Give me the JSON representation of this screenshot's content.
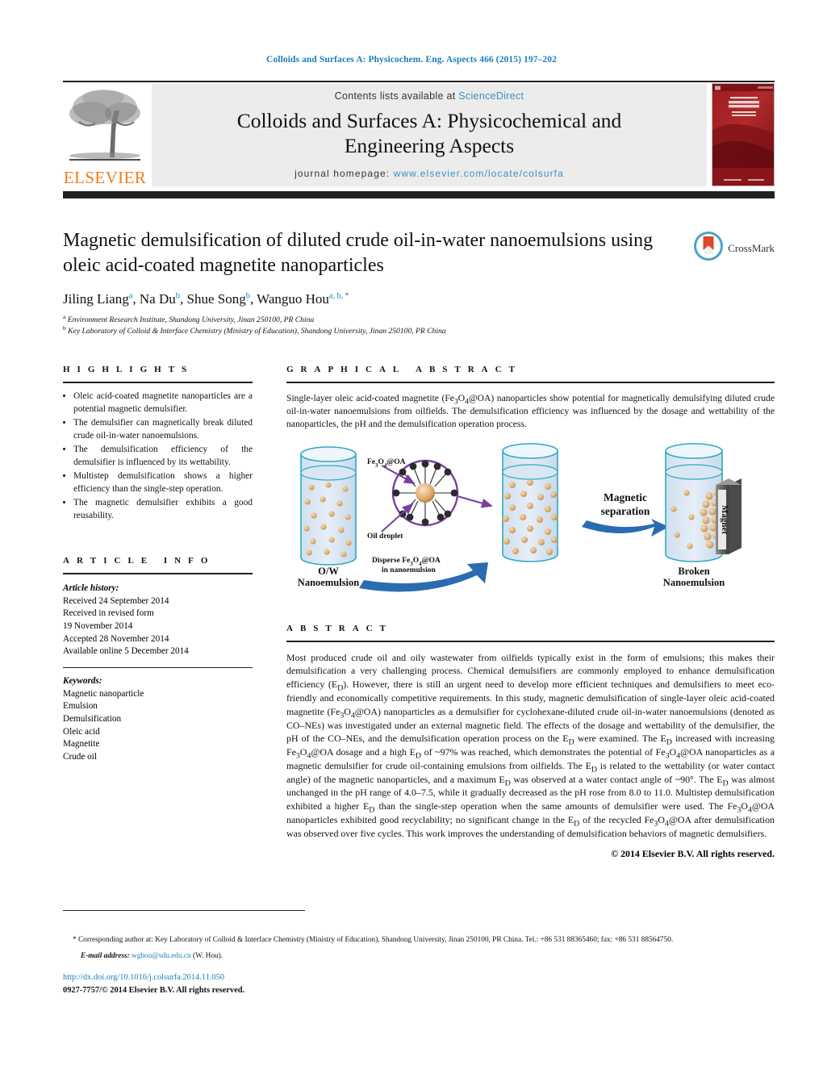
{
  "running_head": "Colloids and Surfaces A: Physicochem. Eng. Aspects 466 (2015) 197–202",
  "masthead": {
    "contents_prefix": "Contents lists available at ",
    "sciencedirect": "ScienceDirect",
    "journal_title_line1": "Colloids and Surfaces A: Physicochemical and",
    "journal_title_line2": "Engineering Aspects",
    "homepage_label": "journal homepage: ",
    "homepage_url": "www.elsevier.com/locate/colsurfa",
    "publisher": "ELSEVIER",
    "cover_line1": "COLLOIDS AND",
    "cover_line2": "SURFACES A",
    "cover_sub": "Physicochemical and Engineering Aspects"
  },
  "article": {
    "title": "Magnetic demulsification of diluted crude oil-in-water nanoemulsions using oleic acid-coated magnetite nanoparticles",
    "crossmark_label": "CrossMark",
    "authors_html": "Jiling Liang<sup>a</sup>, Na Du<sup>b</sup>, Shue Song<sup>b</sup>, Wanguo Hou<sup>a, b, *</sup>",
    "affiliations": [
      {
        "marker": "a",
        "text": "Environment Research Institute, Shandong University, Jinan 250100, PR China"
      },
      {
        "marker": "b",
        "text": "Key Laboratory of Colloid & Interface Chemistry (Ministry of Education), Shandong University, Jinan 250100, PR China"
      }
    ]
  },
  "highlights": {
    "heading": "HIGHLIGHTS",
    "items": [
      "Oleic acid-coated magnetite nanoparticles are a potential magnetic demulsifier.",
      "The demulsifier can magnetically break diluted crude oil-in-water nanoemulsions.",
      "The demulsification efficiency of the demulsifier is influenced by its wettability.",
      "Multistep demulsification shows a higher efficiency than the single-step operation.",
      "The magnetic demulsifier exhibits a good reusability."
    ]
  },
  "article_info": {
    "heading": "ARTICLE INFO",
    "history_label": "Article history:",
    "history": [
      "Received 24 September 2014",
      "Received in revised form",
      "19 November 2014",
      "Accepted 28 November 2014",
      "Available online 5 December 2014"
    ],
    "keywords_label": "Keywords:",
    "keywords": [
      "Magnetic nanoparticle",
      "Emulsion",
      "Demulsification",
      "Oleic acid",
      "Magnetite",
      "Crude oil"
    ]
  },
  "graphical_abstract": {
    "heading": "GRAPHICAL ABSTRACT",
    "text_html": "Single-layer oleic acid-coated magnetite (Fe<sub>3</sub>O<sub>4</sub>@OA) nanoparticles show potential for magnetically demulsifying diluted crude oil-in-water nanoemulsions from oilfields. The demulsification efficiency was influenced by the dosage and wettability of the nanoparticles, the pH and the demulsification operation process.",
    "figure_labels": {
      "left_caption_line1": "O/W",
      "left_caption_line2": "Nanoemulsion",
      "particle_label": "Fe₃3O₃4@OA",
      "particle_label_html": "Fe<sub>3</sub>O<sub>4</sub>@OA",
      "oil_droplet": "Oil droplet",
      "disperse_line1_html": "Disperse Fe<sub>3</sub>O<sub>4</sub>@OA",
      "disperse_line2": "in nanoemulsion",
      "mag_sep_line1": "Magnetic",
      "mag_sep_line2": "separation",
      "magnet": "Magnet",
      "right_caption_line1": "Broken",
      "right_caption_line2": "Nanoemulsion"
    }
  },
  "abstract": {
    "heading": "ABSTRACT",
    "text_html": "Most produced crude oil and oily wastewater from oilfields typically exist in the form of emulsions; this makes their demulsification a very challenging process. Chemical demulsifiers are commonly employed to enhance demulsification efficiency (E<sub>D</sub>). However, there is still an urgent need to develop more efficient techniques and demulsifiers to meet eco-friendly and economically competitive requirements. In this study, magnetic demulsification of single-layer oleic acid-coated magnetite (Fe<sub>3</sub>O<sub>4</sub>@OA) nanoparticles as a demulsifier for cyclohexane-diluted crude oil-in-water nanoemulsions (denoted as CO–NEs) was investigated under an external magnetic field. The effects of the dosage and wettability of the demulsifier, the pH of the CO–NEs, and the demulsification operation process on the E<sub>D</sub> were examined. The E<sub>D</sub> increased with increasing Fe<sub>3</sub>O<sub>4</sub>@OA dosage and a high E<sub>D</sub> of ~97% was reached, which demonstrates the potential of Fe<sub>3</sub>O<sub>4</sub>@OA nanoparticles as a magnetic demulsifier for crude oil-containing emulsions from oilfields. The E<sub>D</sub> is related to the wettability (or water contact angle) of the magnetic nanoparticles, and a maximum E<sub>D</sub> was observed at a water contact angle of ~90°. The E<sub>D</sub> was almost unchanged in the pH range of 4.0–7.5, while it gradually decreased as the pH rose from 8.0 to 11.0. Multistep demulsification exhibited a higher E<sub>D</sub> than the single-step operation when the same amounts of demulsifier were used. The Fe<sub>3</sub>O<sub>4</sub>@OA nanoparticles exhibited good recyclability; no significant change in the E<sub>D</sub> of the recycled Fe<sub>3</sub>O<sub>4</sub>@OA after demulsification was observed over five cycles. This work improves the understanding of demulsification behaviors of magnetic demulsifiers.",
    "copyright": "© 2014 Elsevier B.V. All rights reserved."
  },
  "footer": {
    "corresponding_html": "* Corresponding author at: Key Laboratory of Colloid & Interface Chemistry (Ministry of Education), Shandong University, Jinan 250100, PR China. Tel.: +86 531 88365460; fax: +86 531 88564750.",
    "email_label": "E-mail address:",
    "email": "wghou@sdu.edu.cn",
    "email_owner": "(W. Hou).",
    "doi": "http://dx.doi.org/10.1016/j.colsurfa.2014.11.050",
    "issn_line": "0927-7757/© 2014 Elsevier B.V. All rights reserved."
  },
  "colors": {
    "link_blue": "#1a7fb5",
    "sciencedirect_blue": "#3a8fc0",
    "elsevier_orange": "#f07c1f",
    "rule_black": "#231f20",
    "masthead_gray": "#ececec",
    "beaker_fill": "#dfe9f3",
    "beaker_stroke": "#2fa9c4",
    "droplet": "#e2b47e",
    "arrow_blue": "#2b6cb0",
    "purple": "#7a3fa0",
    "magnet_gray": "#6e6e6e"
  }
}
